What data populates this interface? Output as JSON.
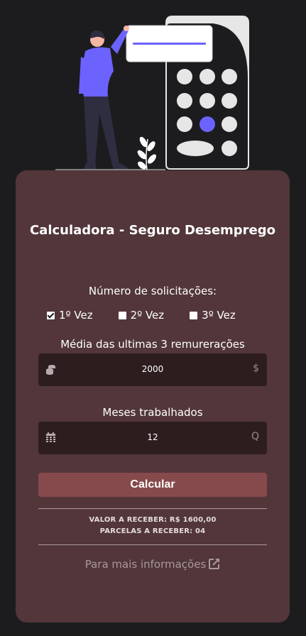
{
  "app": {
    "title": "Calculadora - Seguro Desemprego",
    "accent": "#874a4c",
    "card_color": "#52363a",
    "background": "#1c1c1e"
  },
  "illustration": {
    "icon": "person-with-calculator-illustration"
  },
  "requests": {
    "label": "Número de solicitações:",
    "options": [
      {
        "label": "1º Vez",
        "checked": true
      },
      {
        "label": "2º Vez",
        "checked": false
      },
      {
        "label": "3º Vez",
        "checked": false
      }
    ]
  },
  "salary": {
    "label": "Média das ultimas 3 remurerações",
    "value": "2000",
    "left_icon": "coins-icon",
    "right_symbol": "$"
  },
  "months": {
    "label": "Meses trabalhados",
    "value": "12",
    "left_icon": "calendar-icon",
    "right_symbol": "Q"
  },
  "calculate_label": "Calcular",
  "result": {
    "value_line": "VALOR A RECEBER: R$ 1600,00",
    "installments_line": "PARCELAS A RECEBER: 04"
  },
  "more_info": {
    "label": "Para mais informações",
    "icon": "external-link-icon"
  }
}
